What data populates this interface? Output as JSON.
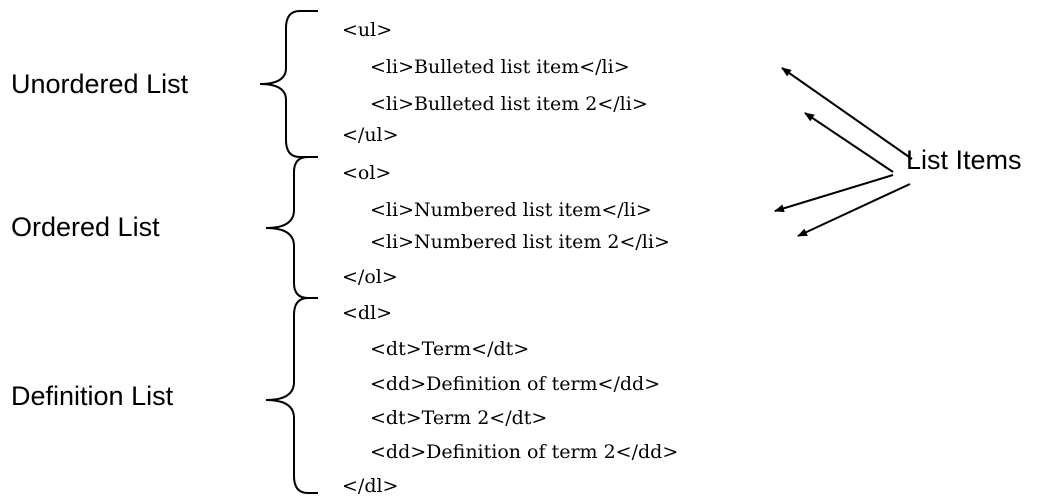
{
  "labels": {
    "unordered": "Unordered List",
    "ordered": "Ordered List",
    "definition": "Definition List",
    "list_items": "List Items"
  },
  "code": {
    "ul_open": "<ul>",
    "ul_item1": "<li>Bulleted list item</li>",
    "ul_item2": "<li>Bulleted list item 2</li>",
    "ul_close": "</ul>",
    "ol_open": "<ol>",
    "ol_item1": "<li>Numbered list item</li>",
    "ol_item2": "<li>Numbered list item 2</li>",
    "ol_close": "</ol>",
    "dl_open": "<dl>",
    "dt1": "<dt>Term</dt>",
    "dd1": "<dd>Definition of term</dd>",
    "dt2": "<dt>Term 2</dt>",
    "dd2": "<dd>Definition of term 2</dd>",
    "dl_close": "</dl>"
  },
  "colors": {
    "ink": "#000000",
    "background": "#ffffff"
  }
}
